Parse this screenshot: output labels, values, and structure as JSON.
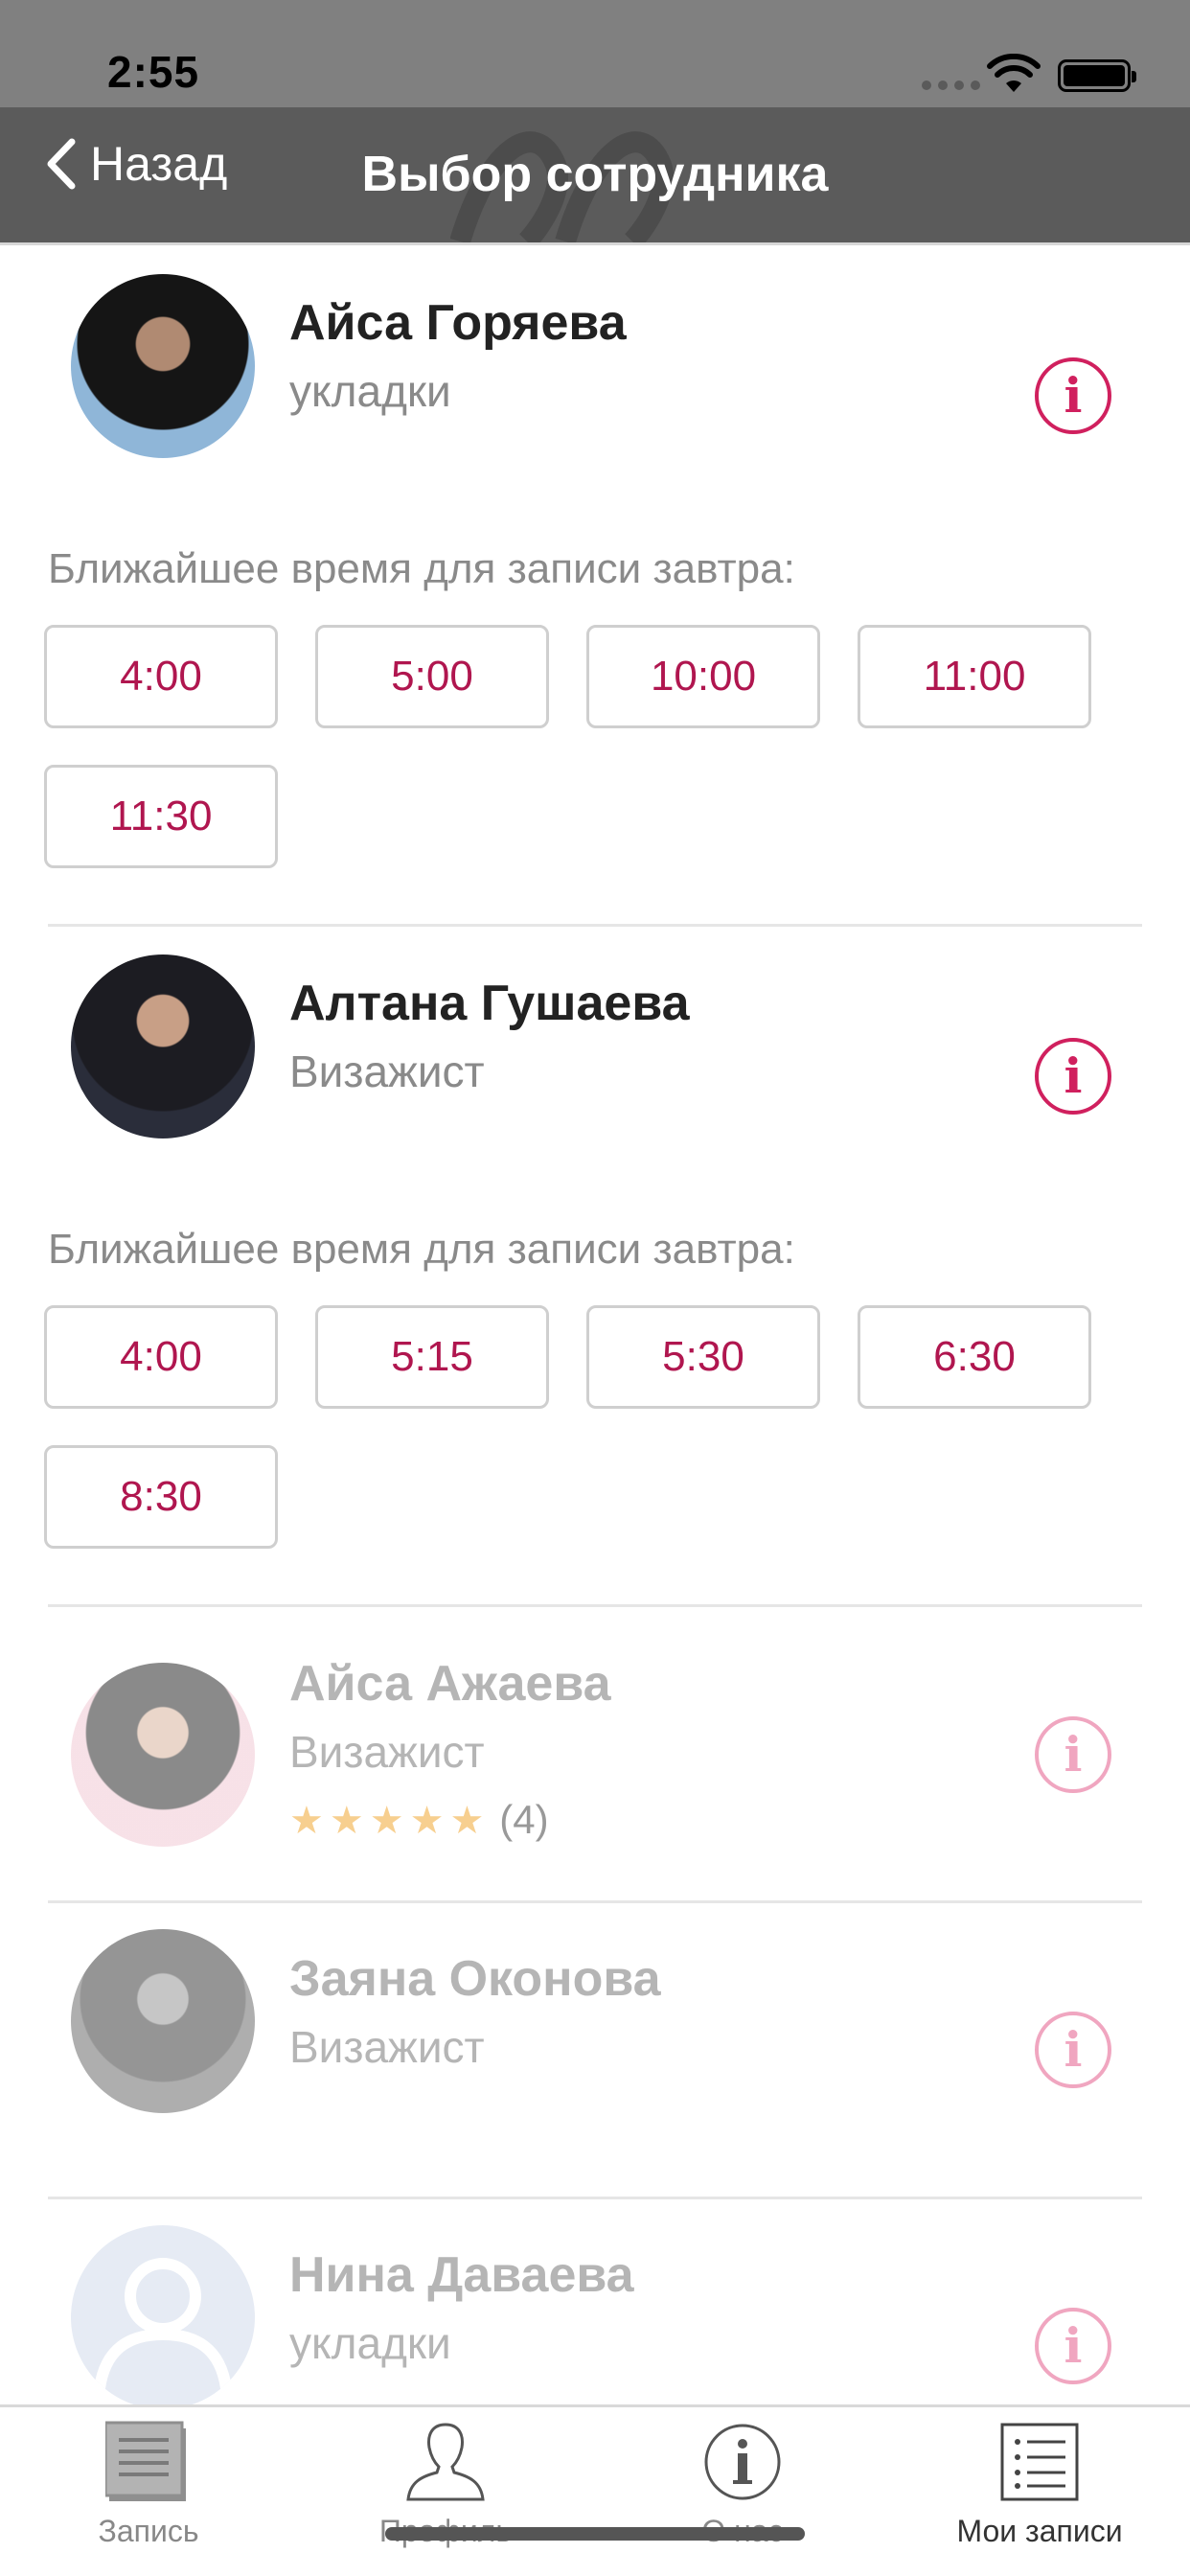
{
  "status_bar": {
    "time": "2:55"
  },
  "nav": {
    "back_label": "Назад",
    "title": "Выбор сотрудника"
  },
  "employees": [
    {
      "name": "Айса Горяева",
      "role": "укладки",
      "nearest_label": "Ближайшее время для записи завтра:",
      "slots": [
        "4:00",
        "5:00",
        "10:00",
        "11:00",
        "11:30"
      ]
    },
    {
      "name": "Алтана Гушаева",
      "role": "Визажист",
      "nearest_label": "Ближайшее время для записи завтра:",
      "slots": [
        "4:00",
        "5:15",
        "5:30",
        "6:30",
        "8:30"
      ]
    },
    {
      "name": "Айса Ажаева",
      "role": "Визажист",
      "rating": {
        "stars": 5,
        "count": "(4)"
      }
    },
    {
      "name": "Заяна Оконова",
      "role": "Визажист"
    },
    {
      "name": "Нина Даваева",
      "role": "укладки"
    }
  ],
  "tabs": [
    {
      "label": "Запись",
      "icon": "document-lines-icon"
    },
    {
      "label": "Профиль",
      "icon": "person-silhouette-icon"
    },
    {
      "label": "О нас",
      "icon": "info-circle-icon"
    },
    {
      "label": "Мои записи",
      "icon": "list-icon"
    }
  ],
  "colors": {
    "accent": "#b0164f",
    "info": "#d0205e",
    "navbar": "#5b5b5b",
    "statusbar": "#808080"
  }
}
